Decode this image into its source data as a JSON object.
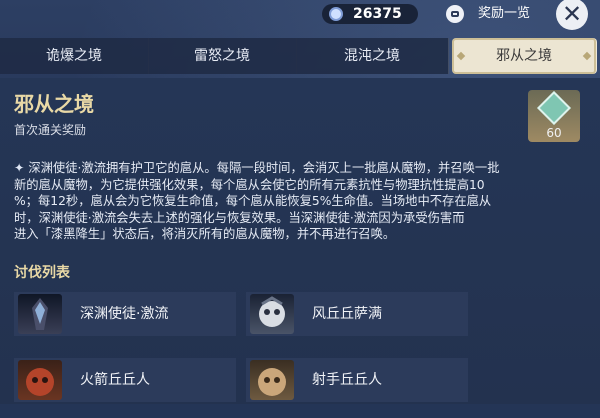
{
  "currency": {
    "value": "26375",
    "icon": "primogem-icon"
  },
  "header": {
    "reward_list_label": "奖励一览"
  },
  "tabs": [
    {
      "label": "诡爆之境"
    },
    {
      "label": "雷怒之境"
    },
    {
      "label": "混沌之境"
    },
    {
      "label": "邪从之境"
    }
  ],
  "domain": {
    "title": "邪从之境",
    "subtitle": "首次通关奖励",
    "reward_count": "60",
    "description_lines": [
      "深渊使徒·激流拥有护卫它的扈从。每隔一段时间，会消灭上一批扈从魔物，并召唤一批",
      "新的扈从魔物，为它提供强化效果，每个扈从会使它的所有元素抗性与物理抗性提高10",
      "%；每12秒，扈从会为它恢复生命值，每个扈从能恢复5%生命值。当场地中不存在扈从",
      "时，深渊使徒·激流会失去上述的强化与恢复效果。当深渊使徒·激流因为承受伤害而",
      "进入「漆黑降生」状态后，将消灭所有的扈从魔物，并不再进行召唤。"
    ]
  },
  "enemy_list": {
    "title": "讨伐列表",
    "items": [
      {
        "name": "深渊使徒·激流"
      },
      {
        "name": "风丘丘萨满"
      },
      {
        "name": "火箭丘丘人"
      },
      {
        "name": "射手丘丘人"
      }
    ]
  }
}
